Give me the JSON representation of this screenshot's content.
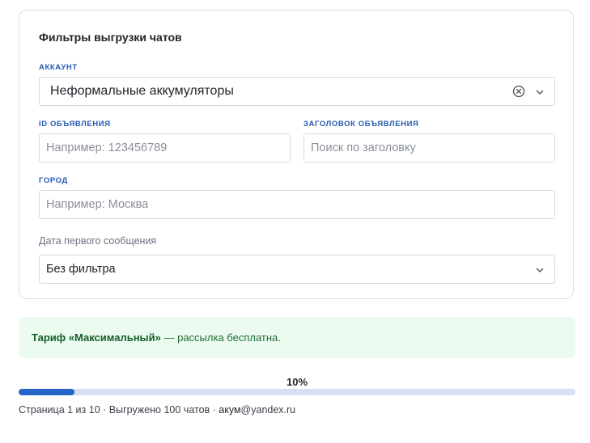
{
  "filters": {
    "title": "Фильтры выгрузки чатов",
    "account": {
      "label": "АККАУНТ",
      "value": "Неформальные аккумуляторы"
    },
    "ad_id": {
      "label": "ID ОБЪЯВЛЕНИЯ",
      "placeholder": "Например: 123456789",
      "value": ""
    },
    "ad_title": {
      "label": "ЗАГОЛОВОК ОБЪЯВЛЕНИЯ",
      "placeholder": "Поиск по заголовку",
      "value": ""
    },
    "city": {
      "label": "ГОРОД",
      "placeholder": "Например: Москва",
      "value": ""
    },
    "first_message_date": {
      "label": "Дата первого сообщения",
      "value": "Без фильтра"
    }
  },
  "tariff_banner": {
    "strong": "Тариф «Максимальный»",
    "text": " — рассылка бесплатна."
  },
  "progress": {
    "label": "10%",
    "fraction": 0.1
  },
  "footer": {
    "status": "Страница 1 из 10 · Выгружено 100 чатов · ",
    "user_name": "акум",
    "email_domain": "@yandex.ru"
  },
  "icons": {
    "clear": "clear-circle-x-icon",
    "chevron": "chevron-down-icon"
  },
  "colors": {
    "accent": "#2563c9",
    "label_blue": "#2458b3",
    "banner_bg": "#ecfbf0",
    "banner_text": "#1e6b34",
    "progress_track": "#d7dff1"
  }
}
